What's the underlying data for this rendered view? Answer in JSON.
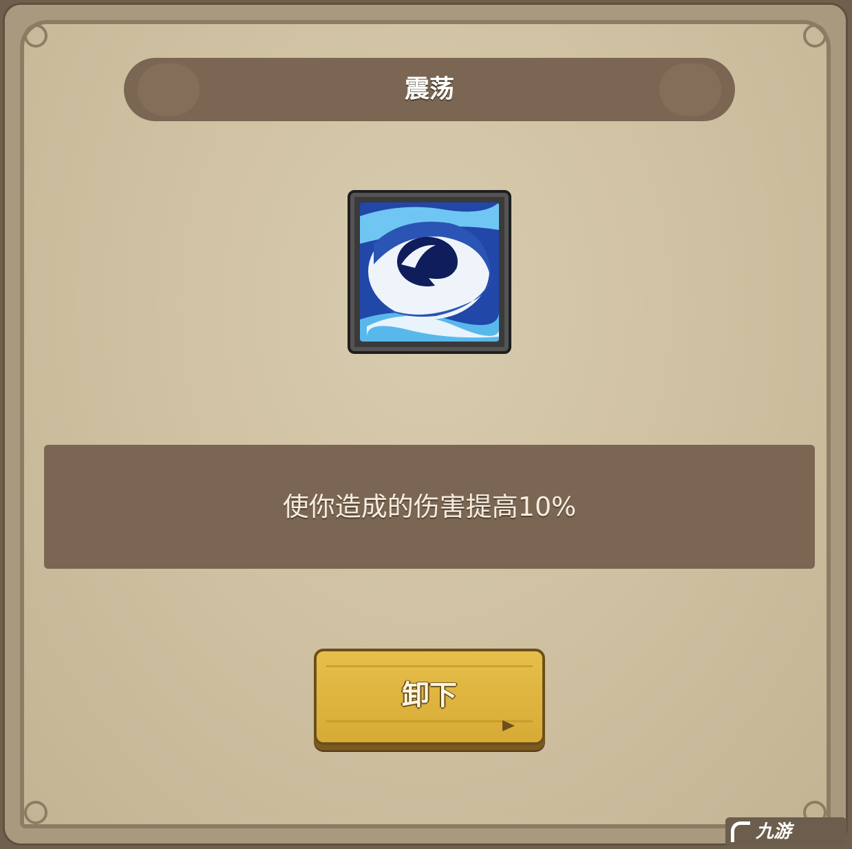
{
  "skill": {
    "name": "震荡",
    "description": "使你造成的伤害提高10%",
    "icon": "whirlpool-icon"
  },
  "actions": {
    "unequip_label": "卸下"
  },
  "watermark": {
    "text": "九游",
    "logo": "9-logo-icon"
  },
  "colors": {
    "banner": "#7a6652",
    "parchment": "#cfc1a1",
    "button": "#e2b940"
  }
}
